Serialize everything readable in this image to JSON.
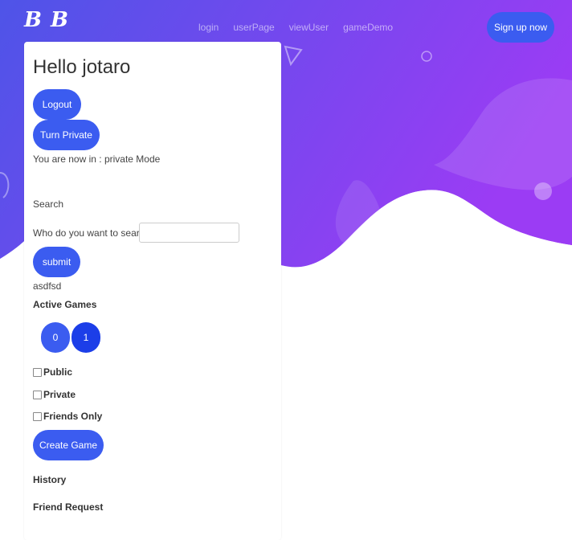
{
  "nav": {
    "logo": "B B",
    "links": [
      "login",
      "userPage",
      "viewUser",
      "gameDemo"
    ],
    "signup": "Sign up now"
  },
  "panel": {
    "greeting": "Hello jotaro",
    "logout": "Logout",
    "turn_private": "Turn Private",
    "mode_text": "You are now in : private Mode",
    "search_heading": "Search",
    "search_prompt": "Who do you want to search up",
    "search_value": "",
    "submit": "submit",
    "result": "asdfsd",
    "active_games": "Active Games",
    "games": [
      "0",
      "1"
    ],
    "options": [
      "Public",
      "Private",
      "Friends Only"
    ],
    "create_game": "Create Game",
    "history": "History",
    "friend_request": "Friend Request"
  },
  "colors": {
    "gradient_start": "#4e54e8",
    "gradient_end": "#9b3cf4",
    "button": "#3b5cf0",
    "selected_game": "#1c3ee8"
  }
}
